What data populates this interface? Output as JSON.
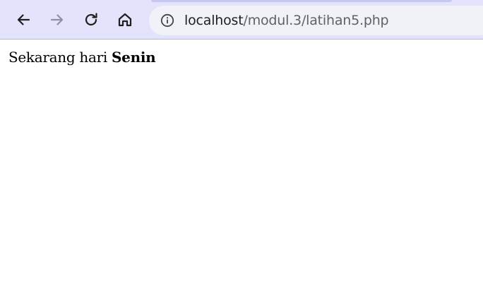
{
  "browser": {
    "back_icon": "arrow-left-icon",
    "forward_icon": "arrow-right-icon",
    "reload_icon": "reload-icon",
    "home_icon": "home-icon",
    "site_info_icon": "info-circle-icon",
    "url_host": "localhost",
    "url_path": "/modul.3/latihan5.php",
    "colors": {
      "toolbar_bg": "#e3e4fb",
      "omnibox_bg": "#f1f2f8",
      "icon_active": "#1f1f1f",
      "icon_disabled": "#8e8fa0"
    }
  },
  "page": {
    "text_prefix": "Sekarang hari ",
    "day_name": "Senin"
  }
}
